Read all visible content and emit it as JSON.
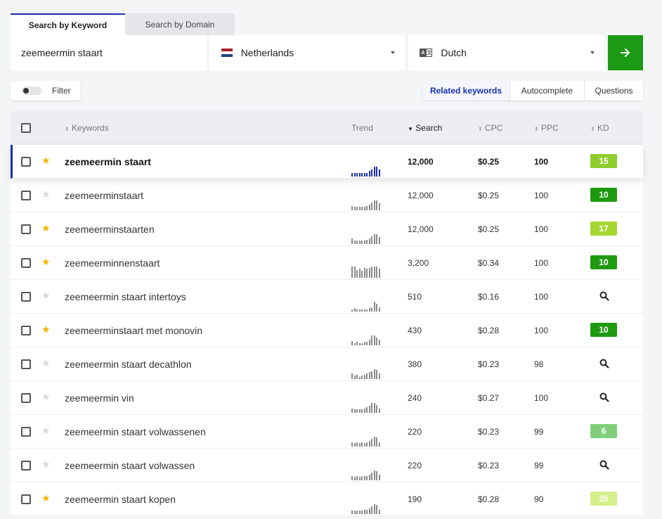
{
  "tabs": {
    "keyword": "Search by Keyword",
    "domain": "Search by Domain"
  },
  "search": {
    "value": "zeemeermin staart",
    "country": "Netherlands",
    "language": "Dutch",
    "go_icon": "arrow-right-icon",
    "lang_icon": "translate-icon"
  },
  "filter": {
    "label": "Filter"
  },
  "segments": {
    "related": "Related keywords",
    "autocomplete": "Autocomplete",
    "questions": "Questions"
  },
  "columns": {
    "keywords": "Keywords",
    "trend": "Trend",
    "search": "Search",
    "cpc": "CPC",
    "ppc": "PPC",
    "kd": "KD"
  },
  "colors": {
    "accent": "#1a2fb0",
    "go": "#1c9a16",
    "star": "#f5b400"
  },
  "rows": [
    {
      "keyword": "zeemeermin staart",
      "starred": true,
      "search": "12,000",
      "cpc": "$0.25",
      "ppc": "100",
      "kd": "15",
      "kd_color": "#8fce2f",
      "trend": [
        0.3,
        0.3,
        0.3,
        0.3,
        0.3,
        0.3,
        0.3,
        0.5,
        0.6,
        0.9,
        0.9,
        0.6
      ],
      "selected": true
    },
    {
      "keyword": "zeemeerminstaart",
      "starred": false,
      "search": "12,000",
      "cpc": "$0.25",
      "ppc": "100",
      "kd": "10",
      "kd_color": "#1f9a10",
      "trend": [
        0.4,
        0.3,
        0.3,
        0.3,
        0.3,
        0.3,
        0.4,
        0.5,
        0.7,
        0.9,
        0.9,
        0.6
      ]
    },
    {
      "keyword": "zeemeerminstaarten",
      "starred": true,
      "search": "12,000",
      "cpc": "$0.25",
      "ppc": "100",
      "kd": "17",
      "kd_color": "#a6d731",
      "trend": [
        0.5,
        0.3,
        0.3,
        0.3,
        0.3,
        0.3,
        0.4,
        0.5,
        0.7,
        0.9,
        0.9,
        0.6
      ]
    },
    {
      "keyword": "zeemeerminnenstaart",
      "starred": true,
      "search": "3,200",
      "cpc": "$0.34",
      "ppc": "100",
      "kd": "10",
      "kd_color": "#1f9a10",
      "trend": [
        1,
        1,
        0.7,
        0.8,
        0.6,
        0.9,
        0.8,
        0.9,
        1,
        1,
        1,
        0.8
      ]
    },
    {
      "keyword": "zeemeermin staart intertoys",
      "starred": false,
      "search": "510",
      "cpc": "$0.16",
      "ppc": "100",
      "kd": "",
      "kd_color": "",
      "trend": [
        0.2,
        0.3,
        0.2,
        0.2,
        0.2,
        0.2,
        0.2,
        0.3,
        0.4,
        0.9,
        0.7,
        0.4
      ]
    },
    {
      "keyword": "zeemeerminstaart met monovin",
      "starred": true,
      "search": "430",
      "cpc": "$0.28",
      "ppc": "100",
      "kd": "10",
      "kd_color": "#1f9a10",
      "trend": [
        0.4,
        0.2,
        0.3,
        0.2,
        0.2,
        0.3,
        0.3,
        0.5,
        0.9,
        0.9,
        0.7,
        0.5
      ]
    },
    {
      "keyword": "zeemeermin staart decathlon",
      "starred": false,
      "search": "380",
      "cpc": "$0.23",
      "ppc": "98",
      "kd": "",
      "kd_color": "",
      "trend": [
        0.5,
        0.3,
        0.4,
        0.2,
        0.3,
        0.4,
        0.5,
        0.6,
        0.7,
        0.9,
        0.8,
        0.5
      ]
    },
    {
      "keyword": "zeemeermin vin",
      "starred": false,
      "search": "240",
      "cpc": "$0.27",
      "ppc": "100",
      "kd": "",
      "kd_color": "",
      "trend": [
        0.4,
        0.3,
        0.3,
        0.3,
        0.3,
        0.4,
        0.5,
        0.6,
        0.9,
        0.9,
        0.7,
        0.4
      ]
    },
    {
      "keyword": "zeemeermin staart volwassenen",
      "starred": false,
      "search": "220",
      "cpc": "$0.23",
      "ppc": "99",
      "kd": "6",
      "kd_color": "#7fcf7a",
      "trend": [
        0.4,
        0.3,
        0.4,
        0.3,
        0.4,
        0.3,
        0.4,
        0.5,
        0.7,
        0.9,
        0.8,
        0.4
      ]
    },
    {
      "keyword": "zeemeermin staart volwassen",
      "starred": false,
      "search": "220",
      "cpc": "$0.23",
      "ppc": "99",
      "kd": "",
      "kd_color": "",
      "trend": [
        0.4,
        0.3,
        0.4,
        0.3,
        0.4,
        0.4,
        0.4,
        0.5,
        0.7,
        0.9,
        0.8,
        0.5
      ]
    },
    {
      "keyword": "zeemeermin staart kopen",
      "starred": true,
      "search": "190",
      "cpc": "$0.28",
      "ppc": "90",
      "kd": "25",
      "kd_color": "#d3ef8a",
      "trend": [
        0.3,
        0.3,
        0.3,
        0.3,
        0.3,
        0.4,
        0.4,
        0.5,
        0.7,
        0.9,
        0.8,
        0.4
      ]
    }
  ]
}
